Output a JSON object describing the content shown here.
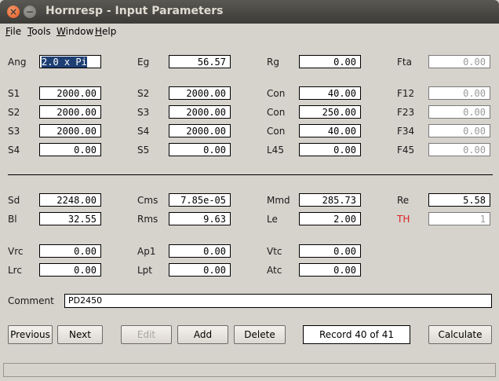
{
  "window": {
    "title": "Hornresp - Input Parameters"
  },
  "menu": {
    "file": "File",
    "tools": "Tools",
    "window": "Window",
    "help": "Help"
  },
  "row_top": {
    "ang": {
      "label": "Ang",
      "value": "2.0 x Pi"
    },
    "eg": {
      "label": "Eg",
      "value": "56.57"
    },
    "rg": {
      "label": "Rg",
      "value": "0.00"
    },
    "fta": {
      "label": "Fta",
      "value": "0.00"
    }
  },
  "horn": [
    [
      {
        "label": "S1",
        "value": "2000.00"
      },
      {
        "label": "S2",
        "value": "2000.00"
      },
      {
        "label": "Con",
        "value": "40.00"
      },
      {
        "label": "F12",
        "value": "0.00"
      }
    ],
    [
      {
        "label": "S2",
        "value": "2000.00"
      },
      {
        "label": "S3",
        "value": "2000.00"
      },
      {
        "label": "Con",
        "value": "250.00"
      },
      {
        "label": "F23",
        "value": "0.00"
      }
    ],
    [
      {
        "label": "S3",
        "value": "2000.00"
      },
      {
        "label": "S4",
        "value": "2000.00"
      },
      {
        "label": "Con",
        "value": "40.00"
      },
      {
        "label": "F34",
        "value": "0.00"
      }
    ],
    [
      {
        "label": "S4",
        "value": "0.00"
      },
      {
        "label": "S5",
        "value": "0.00"
      },
      {
        "label": "L45",
        "value": "0.00"
      },
      {
        "label": "F45",
        "value": "0.00"
      }
    ]
  ],
  "driver": [
    [
      {
        "label": "Sd",
        "value": "2248.00"
      },
      {
        "label": "Cms",
        "value": "7.85e-05"
      },
      {
        "label": "Mmd",
        "value": "285.73"
      },
      {
        "label": "Re",
        "value": "5.58"
      }
    ],
    [
      {
        "label": "Bl",
        "value": "32.55"
      },
      {
        "label": "Rms",
        "value": "9.63"
      },
      {
        "label": "Le",
        "value": "2.00"
      },
      {
        "label": "TH",
        "value": "1"
      }
    ]
  ],
  "chamber": [
    [
      {
        "label": "Vrc",
        "value": "0.00"
      },
      {
        "label": "Ap1",
        "value": "0.00"
      },
      {
        "label": "Vtc",
        "value": "0.00"
      }
    ],
    [
      {
        "label": "Lrc",
        "value": "0.00"
      },
      {
        "label": "Lpt",
        "value": "0.00"
      },
      {
        "label": "Atc",
        "value": "0.00"
      }
    ]
  ],
  "comment": {
    "label": "Comment",
    "value": "PD2450"
  },
  "buttons": {
    "previous": "Previous",
    "next": "Next",
    "edit": "Edit",
    "add": "Add",
    "delete": "Delete",
    "record": "Record 40 of 41",
    "calculate": "Calculate"
  },
  "colors": {
    "th_label": "#dd2222",
    "selection": "#1d3f74"
  }
}
